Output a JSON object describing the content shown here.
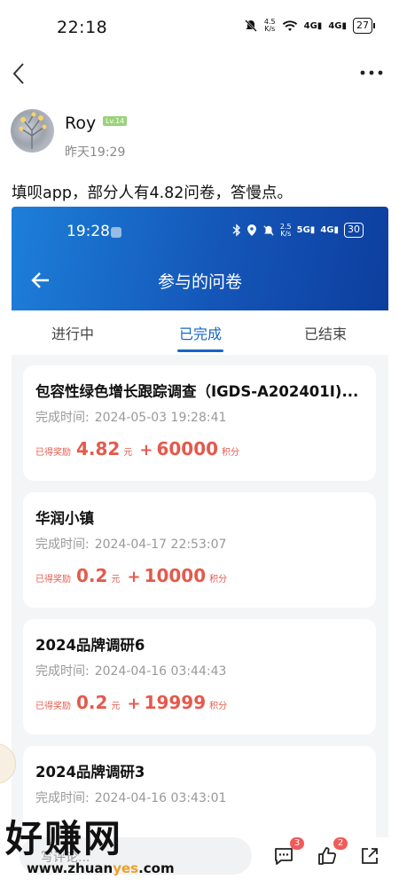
{
  "status_bar": {
    "time": "22:18",
    "speed_value": "4.5",
    "speed_unit": "K/s",
    "signal1": "4G",
    "signal2": "4G",
    "battery": "27"
  },
  "post": {
    "author": "Roy",
    "level": "Lv.14",
    "time": "昨天19:29",
    "text": "填呗app，部分人有4.82问卷，答慢点。"
  },
  "embedded": {
    "status_bar": {
      "time": "19:28",
      "speed_value": "2.5",
      "speed_unit": "K/s",
      "signal1": "5G",
      "signal2": "4G",
      "battery": "30"
    },
    "title": "参与的问卷",
    "tabs": [
      {
        "label": "进行中",
        "active": false
      },
      {
        "label": "已完成",
        "active": true
      },
      {
        "label": "已结束",
        "active": false
      }
    ],
    "time_label": "完成时间:",
    "reward_label": "已得奖励",
    "money_unit": "元",
    "points_unit": "积分",
    "cards": [
      {
        "title": "包容性绿色增长跟踪调查（IGDS-A202401I)...",
        "time": "2024-05-03 19:28:41",
        "money": "4.82",
        "points": "60000"
      },
      {
        "title": "华润小镇",
        "time": "2024-04-17 22:53:07",
        "money": "0.2",
        "points": "10000"
      },
      {
        "title": "2024品牌调研6",
        "time": "2024-04-16 03:44:43",
        "money": "0.2",
        "points": "19999"
      },
      {
        "title": "2024品牌调研3",
        "time": "2024-04-16 03:43:01",
        "money": "",
        "points": ""
      }
    ]
  },
  "watermark": {
    "text": "好赚网",
    "url_prefix": "www.zhuan",
    "url_highlight": "yes",
    "url_suffix": ".com"
  },
  "bottom_bar": {
    "comment_placeholder": "写评论...",
    "comment_count": "3",
    "like_count": "2"
  },
  "colors": {
    "accent_blue": "#1565c8",
    "reward_red": "#e45a4d",
    "badge_red": "#f05a5a"
  }
}
